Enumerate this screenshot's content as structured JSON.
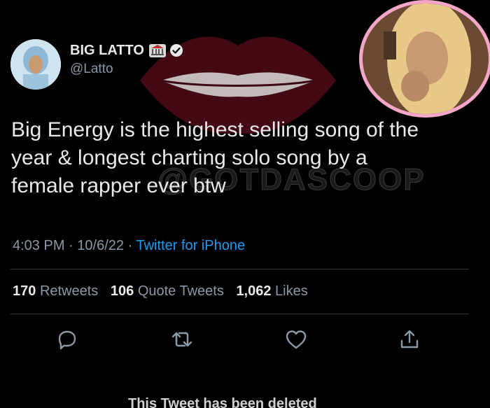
{
  "user": {
    "display_name": "BIG LATTO",
    "handle": "@Latto",
    "badge_icon": "bank-emoji-icon",
    "verified_icon": "verified-check-icon"
  },
  "tweet": {
    "lines": [
      "Big Energy is the highest selling song of the",
      "year & longest charting solo song by a",
      "female rapper ever btw"
    ],
    "time": "4:03 PM",
    "date": "10/6/22",
    "separator": "·",
    "source": "Twitter for iPhone"
  },
  "stats": {
    "retweets_count": "170",
    "retweets_label": "Retweets",
    "quotes_count": "106",
    "quotes_label": "Quote Tweets",
    "likes_count": "1,062",
    "likes_label": "Likes"
  },
  "actions": [
    "reply-icon",
    "retweet-icon",
    "like-icon",
    "share-icon"
  ],
  "watermark": {
    "text": "@GOTDASCOOP"
  },
  "footer": {
    "deleted_text": "This Tweet has been deleted"
  },
  "colors": {
    "background": "#000000",
    "link": "#1d9bf0",
    "secondary": "#8b98a5",
    "primary": "#e7e9ea",
    "inset_border": "#f4a6c8"
  }
}
